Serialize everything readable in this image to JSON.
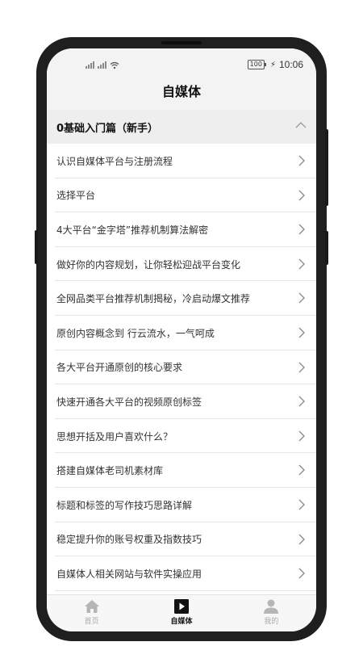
{
  "statusbar": {
    "time": "10:06",
    "battery": "100"
  },
  "navbar": {
    "title": "自媒体"
  },
  "section": {
    "title": "0基础入门篇（新手）"
  },
  "items": [
    {
      "label": "认识自媒体平台与注册流程"
    },
    {
      "label": "选择平台"
    },
    {
      "label": "4大平台“金字塔”推荐机制算法解密"
    },
    {
      "label": "做好你的内容规划，让你轻松迎战平台变化"
    },
    {
      "label": "全网品类平台推荐机制揭秘，冷启动爆文推荐"
    },
    {
      "label": "原创内容概念到 行云流水，一气呵成"
    },
    {
      "label": "各大平台开通原创的核心要求"
    },
    {
      "label": "快速开通各大平台的视频原创标签"
    },
    {
      "label": "思想开括及用户喜欢什么？"
    },
    {
      "label": "搭建自媒体老司机素材库"
    },
    {
      "label": "标题和标签的写作技巧思路详解"
    },
    {
      "label": "稳定提升你的账号权重及指数技巧"
    },
    {
      "label": "自媒体人相关网站与软件实操应用"
    }
  ],
  "tabs": [
    {
      "label": "首页",
      "icon": "home-icon"
    },
    {
      "label": "自媒体",
      "icon": "play-icon"
    },
    {
      "label": "我的",
      "icon": "user-icon"
    }
  ]
}
